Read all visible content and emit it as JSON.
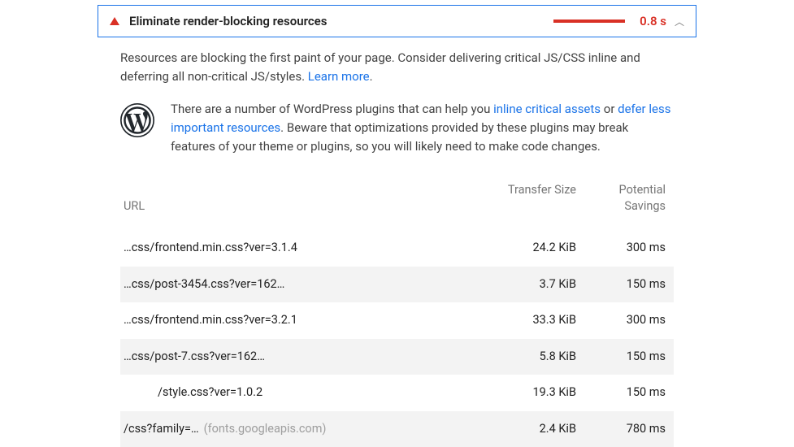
{
  "audit": {
    "title": "Eliminate render-blocking resources",
    "time": "0.8 s",
    "description_pre": "Resources are blocking the first paint of your page. Consider delivering critical JS/CSS inline and deferring all non-critical JS/styles. ",
    "learn_more": "Learn more",
    "wp_text_1": "There are a number of WordPress plugins that can help you ",
    "wp_link_1": "inline critical assets",
    "wp_text_2": " or ",
    "wp_link_2": "defer less important resources",
    "wp_text_3": ". Beware that optimizations provided by these plugins may break features of your theme or plugins, so you will likely need to make code changes."
  },
  "table": {
    "headers": {
      "url": "URL",
      "size": "Transfer Size",
      "savings": "Potential Savings"
    },
    "rows": [
      {
        "url": "…css/frontend.min.css?ver=3.1.4",
        "suffix": "",
        "indent": false,
        "size": "24.2 KiB",
        "savings": "300 ms"
      },
      {
        "url": "…css/post-3454.css?ver=162…",
        "suffix": "",
        "indent": false,
        "size": "3.7 KiB",
        "savings": "150 ms"
      },
      {
        "url": "…css/frontend.min.css?ver=3.2.1",
        "suffix": "",
        "indent": false,
        "size": "33.3 KiB",
        "savings": "300 ms"
      },
      {
        "url": "…css/post-7.css?ver=162…",
        "suffix": "",
        "indent": false,
        "size": "5.8 KiB",
        "savings": "150 ms"
      },
      {
        "url": "/style.css?ver=1.0.2",
        "suffix": "",
        "indent": true,
        "size": "19.3 KiB",
        "savings": "150 ms"
      },
      {
        "url": "/css?family=…",
        "suffix": "(fonts.googleapis.com)",
        "indent": false,
        "size": "2.4 KiB",
        "savings": "780 ms"
      }
    ]
  }
}
